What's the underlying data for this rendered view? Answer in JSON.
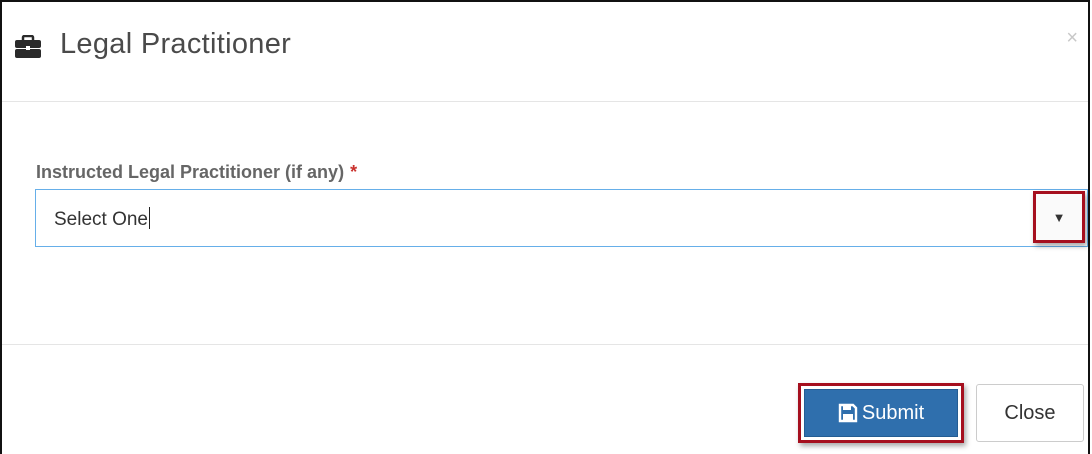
{
  "dialog": {
    "title": "Legal Practitioner",
    "header_icon": "briefcase-icon",
    "close_icon_label": "×"
  },
  "form": {
    "field_label": "Instructed Legal Practitioner (if any)",
    "required_marker": "*",
    "select_value": "Select One",
    "dropdown_arrow": "▼"
  },
  "footer": {
    "submit_label": "Submit",
    "submit_icon": "save-icon",
    "close_label": "Close"
  },
  "colors": {
    "primary_button": "#2f6fad",
    "highlight_border": "#a50f1e",
    "required": "#c9302c",
    "focus_border": "#66afe9"
  }
}
